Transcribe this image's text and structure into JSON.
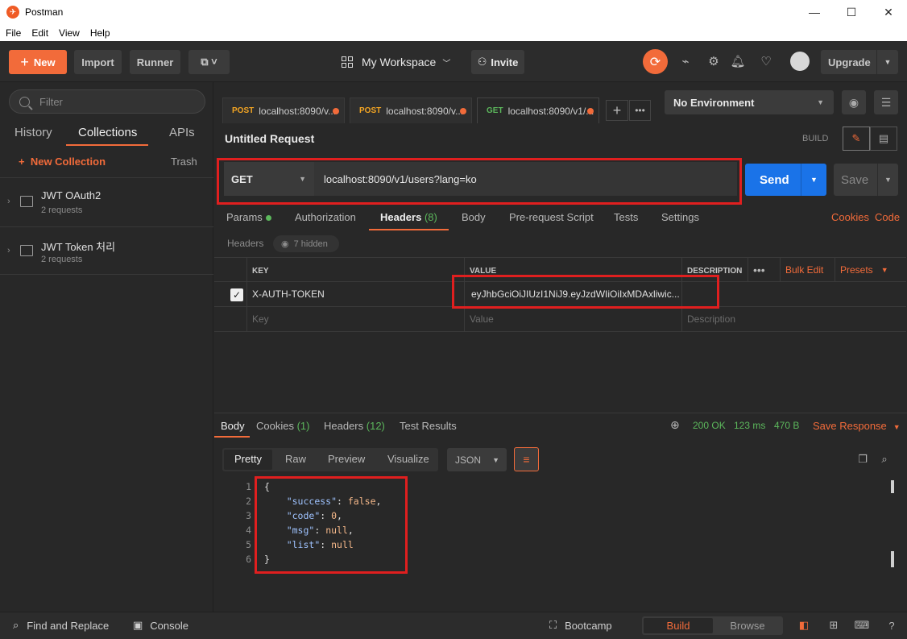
{
  "window": {
    "title": "Postman"
  },
  "menu": [
    "File",
    "Edit",
    "View",
    "Help"
  ],
  "header": {
    "new_label": "New",
    "import_label": "Import",
    "runner_label": "Runner",
    "workspace_label": "My Workspace",
    "invite_label": "Invite",
    "upgrade_label": "Upgrade"
  },
  "sidebar": {
    "filter_placeholder": "Filter",
    "tabs": [
      "History",
      "Collections",
      "APIs"
    ],
    "new_collection": "New Collection",
    "trash": "Trash",
    "collections": [
      {
        "name": "JWT OAuth2",
        "count": "2 requests"
      },
      {
        "name": "JWT Token 처리",
        "count": "2 requests"
      }
    ]
  },
  "tabs": [
    {
      "method": "POST",
      "label": "localhost:8090/v..."
    },
    {
      "method": "POST",
      "label": "localhost:8090/v..."
    },
    {
      "method": "GET",
      "label": "localhost:8090/v1/..."
    }
  ],
  "environment": {
    "label": "No Environment"
  },
  "request": {
    "title": "Untitled Request",
    "build_label": "BUILD",
    "method": "GET",
    "url": "localhost:8090/v1/users?lang=ko",
    "send_label": "Send",
    "save_label": "Save"
  },
  "subtabs": {
    "params": "Params",
    "authorization": "Authorization",
    "headers": "Headers",
    "headers_count": "(8)",
    "body": "Body",
    "prerequest": "Pre-request Script",
    "tests": "Tests",
    "settings": "Settings",
    "cookies": "Cookies",
    "code": "Code"
  },
  "headers_section": {
    "label": "Headers",
    "hidden": "7 hidden",
    "col_key": "KEY",
    "col_value": "VALUE",
    "col_description": "DESCRIPTION",
    "bulk_edit": "Bulk Edit",
    "presets": "Presets",
    "rows": [
      {
        "key": "X-AUTH-TOKEN",
        "value": "eyJhbGciOiJIUzI1NiJ9.eyJzdWIiOiIxMDAxliwic...",
        "checked": true
      }
    ],
    "key_placeholder": "Key",
    "value_placeholder": "Value",
    "description_placeholder": "Description"
  },
  "response": {
    "tabs": {
      "body": "Body",
      "cookies": "Cookies",
      "cookies_count": "(1)",
      "headers": "Headers",
      "headers_count": "(12)",
      "test_results": "Test Results"
    },
    "status": "200 OK",
    "time": "123 ms",
    "size": "470 B",
    "save_response": "Save Response",
    "formats": [
      "Pretty",
      "Raw",
      "Preview",
      "Visualize"
    ],
    "format_select": "JSON",
    "lines": [
      {
        "n": "1",
        "text": "{"
      },
      {
        "n": "2",
        "key": "\"success\"",
        "val": "false",
        "sep": ","
      },
      {
        "n": "3",
        "key": "\"code\"",
        "val": "0",
        "sep": ","
      },
      {
        "n": "4",
        "key": "\"msg\"",
        "val": "null",
        "sep": ","
      },
      {
        "n": "5",
        "key": "\"list\"",
        "val": "null",
        "sep": ""
      },
      {
        "n": "6",
        "text": "}"
      }
    ]
  },
  "statusbar": {
    "find_replace": "Find and Replace",
    "console": "Console",
    "bootcamp": "Bootcamp",
    "build": "Build",
    "browse": "Browse"
  },
  "colors": {
    "accent": "#f26b3a",
    "send": "#1a73e8",
    "success": "#5cb85c",
    "highlight": "#e01f1f"
  }
}
